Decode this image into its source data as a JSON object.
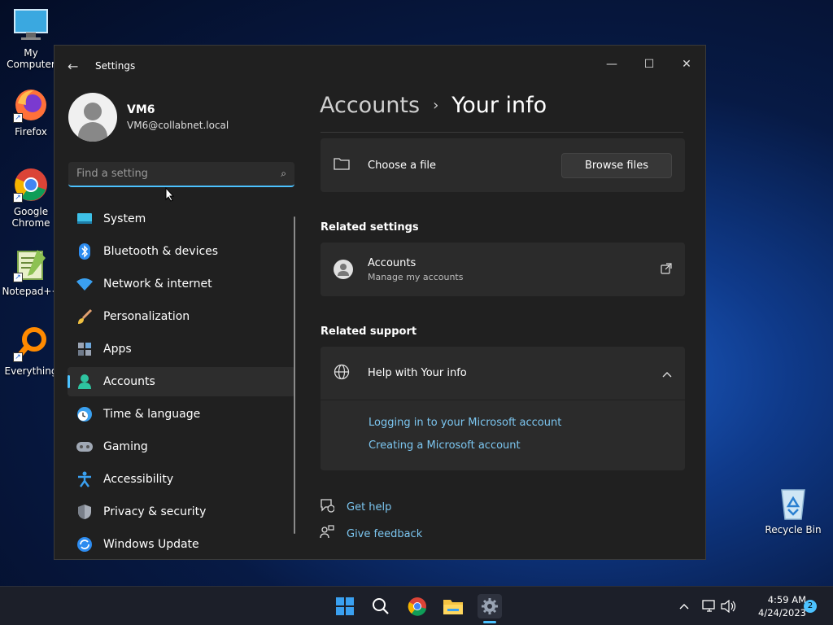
{
  "desktop": {
    "icons": [
      {
        "label": "My Computer"
      },
      {
        "label": "Firefox"
      },
      {
        "label": "Google Chrome"
      },
      {
        "label": "Notepad++"
      },
      {
        "label": "Everything"
      },
      {
        "label": "Recycle Bin"
      }
    ]
  },
  "window": {
    "title": "Settings",
    "controls": {
      "minimize": "—",
      "maximize": "☐",
      "close": "✕"
    }
  },
  "profile": {
    "name": "VM6",
    "email": "VM6@collabnet.local"
  },
  "search": {
    "placeholder": "Find a setting"
  },
  "nav": {
    "items": [
      {
        "label": "System",
        "icon": "system-icon"
      },
      {
        "label": "Bluetooth & devices",
        "icon": "bluetooth-icon"
      },
      {
        "label": "Network & internet",
        "icon": "wifi-icon"
      },
      {
        "label": "Personalization",
        "icon": "brush-icon"
      },
      {
        "label": "Apps",
        "icon": "apps-icon"
      },
      {
        "label": "Accounts",
        "icon": "accounts-icon",
        "active": true
      },
      {
        "label": "Time & language",
        "icon": "clock-globe-icon"
      },
      {
        "label": "Gaming",
        "icon": "gamepad-icon"
      },
      {
        "label": "Accessibility",
        "icon": "accessibility-icon"
      },
      {
        "label": "Privacy & security",
        "icon": "shield-icon"
      },
      {
        "label": "Windows Update",
        "icon": "update-icon"
      }
    ]
  },
  "main": {
    "breadcrumb": {
      "parent": "Accounts",
      "separator": "›",
      "current": "Your info"
    },
    "choose_file": {
      "label": "Choose a file",
      "button": "Browse files"
    },
    "related_settings": {
      "title": "Related settings",
      "accounts": {
        "title": "Accounts",
        "subtitle": "Manage my accounts"
      }
    },
    "related_support": {
      "title": "Related support",
      "help": {
        "title": "Help with Your info"
      },
      "links": [
        "Logging in to your Microsoft account",
        "Creating a Microsoft account"
      ]
    },
    "footer": {
      "get_help": "Get help",
      "give_feedback": "Give feedback"
    }
  },
  "taskbar": {
    "time": "4:59 AM",
    "date": "4/24/2023",
    "notification_count": "2"
  },
  "colors": {
    "accent": "#4cc2ff",
    "link": "#7cc6f0"
  }
}
